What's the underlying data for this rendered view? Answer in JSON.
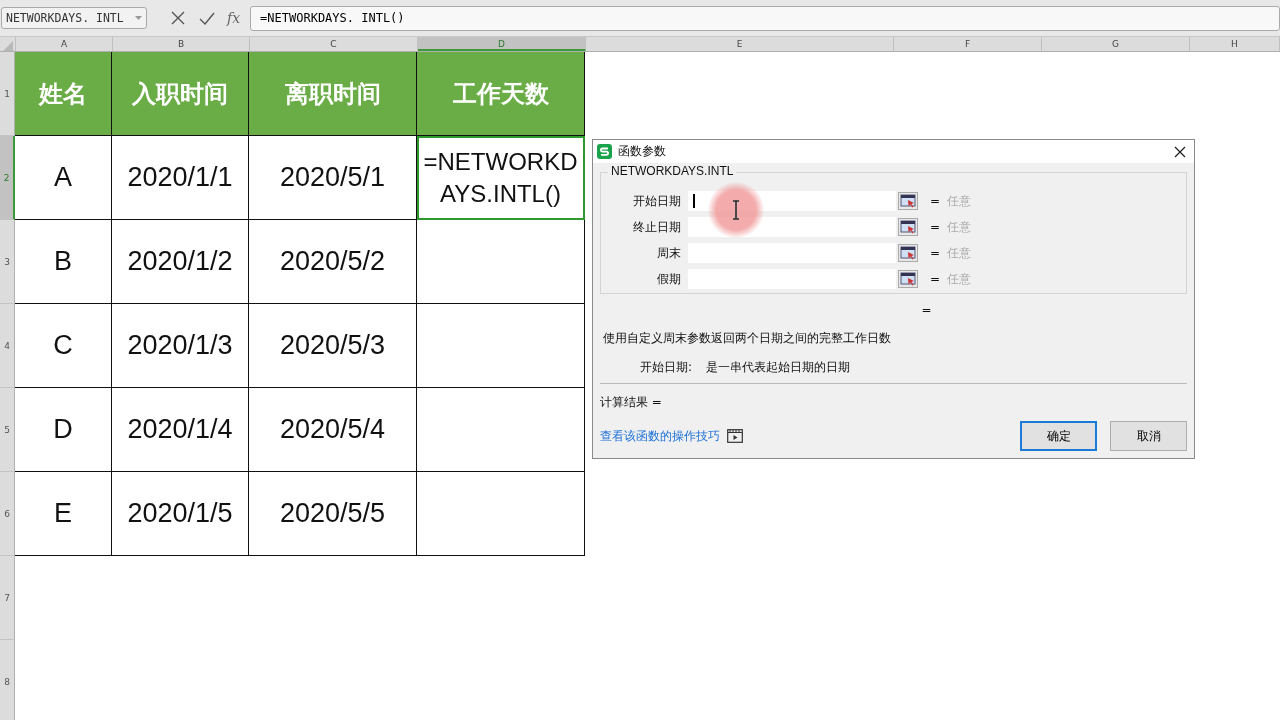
{
  "name_box": {
    "value": "NETWORKDAYS. INTL"
  },
  "formula_bar": {
    "fx": "fx",
    "value": "=NETWORKDAYS. INTL()"
  },
  "columns": [
    {
      "label": "A",
      "selected": false
    },
    {
      "label": "B",
      "selected": false
    },
    {
      "label": "C",
      "selected": false
    },
    {
      "label": "D",
      "selected": true
    },
    {
      "label": "E",
      "selected": false
    },
    {
      "label": "F",
      "selected": false
    },
    {
      "label": "G",
      "selected": false
    },
    {
      "label": "H",
      "selected": false
    }
  ],
  "rows": [
    {
      "label": "1",
      "selected": false,
      "kind": "header",
      "cells": [
        {
          "text": "姓名",
          "selected": false
        },
        {
          "text": "入职时间",
          "selected": false
        },
        {
          "text": "离职时间",
          "selected": false
        },
        {
          "text": "工作天数",
          "selected": false
        }
      ]
    },
    {
      "label": "2",
      "selected": true,
      "kind": "data",
      "cells": [
        {
          "text": "A",
          "selected": false
        },
        {
          "text": "2020/1/1",
          "selected": false
        },
        {
          "text": "2020/5/1",
          "selected": false
        },
        {
          "text": "=NETWORKDAYS.INTL()",
          "selected": true
        }
      ]
    },
    {
      "label": "3",
      "selected": false,
      "kind": "data",
      "cells": [
        {
          "text": "B",
          "selected": false
        },
        {
          "text": "2020/1/2",
          "selected": false
        },
        {
          "text": "2020/5/2",
          "selected": false
        },
        {
          "selected": false
        }
      ]
    },
    {
      "label": "4",
      "selected": false,
      "kind": "data",
      "cells": [
        {
          "text": "C",
          "selected": false
        },
        {
          "text": "2020/1/3",
          "selected": false
        },
        {
          "text": "2020/5/3",
          "selected": false
        },
        {
          "selected": false
        }
      ]
    },
    {
      "label": "5",
      "selected": false,
      "kind": "data",
      "cells": [
        {
          "text": "D",
          "selected": false
        },
        {
          "text": "2020/1/4",
          "selected": false
        },
        {
          "text": "2020/5/4",
          "selected": false
        },
        {
          "selected": false
        }
      ]
    },
    {
      "label": "6",
      "selected": false,
      "kind": "data",
      "cells": [
        {
          "text": "E",
          "selected": false
        },
        {
          "text": "2020/1/5",
          "selected": false
        },
        {
          "text": "2020/5/5",
          "selected": false
        },
        {
          "selected": false
        }
      ]
    },
    {
      "label": "7",
      "selected": false,
      "kind": "empty",
      "cells": []
    },
    {
      "label": "8",
      "selected": false,
      "kind": "empty",
      "cells": []
    }
  ],
  "dialog": {
    "title": "函数参数",
    "function_name": "NETWORKDAYS.INTL",
    "arguments": [
      {
        "label": "开始日期",
        "focused": true,
        "equals": "=",
        "result": "任意"
      },
      {
        "label": "终止日期",
        "focused": false,
        "equals": "=",
        "result": "任意"
      },
      {
        "label": "周末",
        "focused": false,
        "equals": "=",
        "result": "任意"
      },
      {
        "label": "假期",
        "focused": false,
        "equals": "=",
        "result": "任意"
      }
    ],
    "formula_result": "=",
    "description": "使用自定义周末参数返回两个日期之间的完整工作日数",
    "argument_help": {
      "label": "开始日期:",
      "text": "是一串代表起始日期的日期"
    },
    "calc_result": "计算结果 =",
    "link": "查看该函数的操作技巧",
    "buttons": [
      {
        "label": "确定",
        "kind": "primary"
      },
      {
        "label": "取消",
        "kind": "secondary"
      }
    ]
  }
}
